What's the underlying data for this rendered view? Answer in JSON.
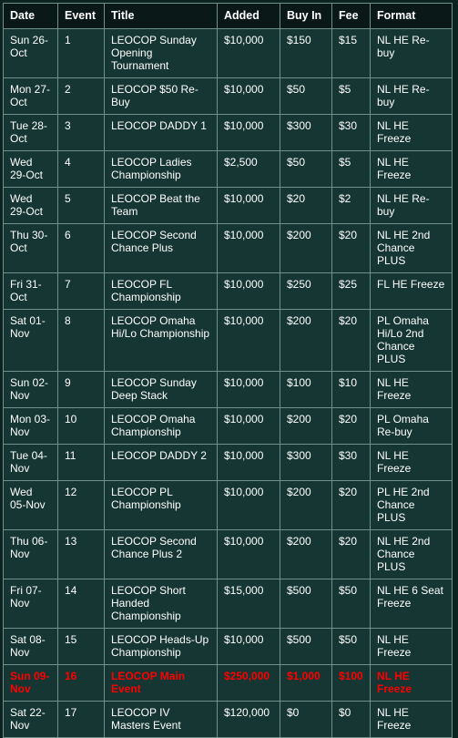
{
  "table": {
    "columns": [
      {
        "key": "date",
        "label": "Date"
      },
      {
        "key": "event",
        "label": "Event"
      },
      {
        "key": "title",
        "label": "Title"
      },
      {
        "key": "added",
        "label": "Added"
      },
      {
        "key": "buyin",
        "label": "Buy In"
      },
      {
        "key": "fee",
        "label": "Fee"
      },
      {
        "key": "format",
        "label": "Format"
      }
    ],
    "colors": {
      "page_background": "#0d2320",
      "cell_background": "#153632",
      "header_background": "#0a1917",
      "border": "#6f9189",
      "text": "#ffffff",
      "highlight_text": "#ff0000"
    },
    "rows": [
      {
        "date": "Sun 26-Oct",
        "event": "1",
        "title": "LEOCOP Sunday Opening Tournament",
        "added": "$10,000",
        "buyin": "$150",
        "fee": "$15",
        "format": "NL HE Re-buy",
        "highlight": false
      },
      {
        "date": "Mon 27-Oct",
        "event": "2",
        "title": "LEOCOP $50 Re-Buy",
        "added": "$10,000",
        "buyin": "$50",
        "fee": "$5",
        "format": "NL HE Re-buy",
        "highlight": false
      },
      {
        "date": "Tue 28-Oct",
        "event": "3",
        "title": "LEOCOP DADDY 1",
        "added": "$10,000",
        "buyin": "$300",
        "fee": "$30",
        "format": "NL HE Freeze",
        "highlight": false
      },
      {
        "date": "Wed 29-Oct",
        "event": "4",
        "title": "LEOCOP Ladies Championship",
        "added": "$2,500",
        "buyin": "$50",
        "fee": "$5",
        "format": "NL HE Freeze",
        "highlight": false
      },
      {
        "date": "Wed 29-Oct",
        "event": "5",
        "title": "LEOCOP Beat the Team",
        "added": "$10,000",
        "buyin": "$20",
        "fee": "$2",
        "format": "NL HE Re-buy",
        "highlight": false
      },
      {
        "date": "Thu 30-Oct",
        "event": "6",
        "title": "LEOCOP Second Chance Plus",
        "added": "$10,000",
        "buyin": "$200",
        "fee": "$20",
        "format": "NL HE 2nd Chance PLUS",
        "highlight": false
      },
      {
        "date": "Fri 31-Oct",
        "event": "7",
        "title": "LEOCOP FL Championship",
        "added": "$10,000",
        "buyin": "$250",
        "fee": "$25",
        "format": "FL HE Freeze",
        "highlight": false
      },
      {
        "date": "Sat 01-Nov",
        "event": "8",
        "title": "LEOCOP Omaha Hi/Lo Championship",
        "added": "$10,000",
        "buyin": "$200",
        "fee": "$20",
        "format": "PL Omaha Hi/Lo 2nd Chance PLUS",
        "highlight": false
      },
      {
        "date": "Sun 02-Nov",
        "event": "9",
        "title": "LEOCOP Sunday Deep Stack",
        "added": "$10,000",
        "buyin": "$100",
        "fee": "$10",
        "format": "NL HE Freeze",
        "highlight": false
      },
      {
        "date": "Mon 03-Nov",
        "event": "10",
        "title": "LEOCOP Omaha Championship",
        "added": "$10,000",
        "buyin": "$200",
        "fee": "$20",
        "format": "PL Omaha Re-buy",
        "highlight": false
      },
      {
        "date": "Tue 04-Nov",
        "event": "11",
        "title": "LEOCOP DADDY 2",
        "added": "$10,000",
        "buyin": "$300",
        "fee": "$30",
        "format": "NL HE Freeze",
        "highlight": false
      },
      {
        "date": "Wed 05-Nov",
        "event": "12",
        "title": "LEOCOP PL Championship",
        "added": "$10,000",
        "buyin": "$200",
        "fee": "$20",
        "format": "PL HE 2nd Chance PLUS",
        "highlight": false
      },
      {
        "date": "Thu 06-Nov",
        "event": "13",
        "title": "LEOCOP Second Chance Plus 2",
        "added": "$10,000",
        "buyin": "$200",
        "fee": "$20",
        "format": "NL HE 2nd Chance PLUS",
        "highlight": false
      },
      {
        "date": "Fri 07-Nov",
        "event": "14",
        "title": "LEOCOP Short Handed Championship",
        "added": "$15,000",
        "buyin": "$500",
        "fee": "$50",
        "format": "NL HE 6 Seat Freeze",
        "highlight": false
      },
      {
        "date": "Sat 08-Nov",
        "event": "15",
        "title": "LEOCOP Heads-Up Championship",
        "added": "$10,000",
        "buyin": "$500",
        "fee": "$50",
        "format": "NL HE Freeze",
        "highlight": false
      },
      {
        "date": "Sun 09-Nov",
        "event": "16",
        "title": "LEOCOP Main Event",
        "added": "$250,000",
        "buyin": "$1,000",
        "fee": "$100",
        "format": "NL HE Freeze",
        "highlight": true
      },
      {
        "date": "Sat 22-Nov",
        "event": "17",
        "title": "LEOCOP IV Masters Event",
        "added": "$120,000",
        "buyin": "$0",
        "fee": "$0",
        "format": "NL HE Freeze",
        "highlight": false
      }
    ]
  }
}
